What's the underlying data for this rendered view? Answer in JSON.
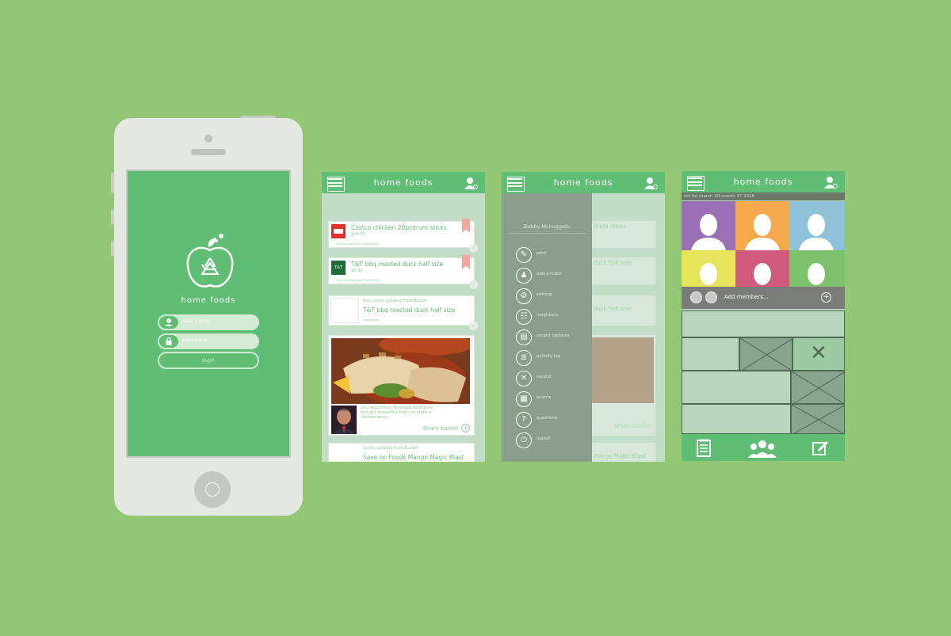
{
  "login": {
    "app_name": "home foods",
    "username_placeholder": "user name",
    "password_placeholder": "password",
    "login_label": "login"
  },
  "header": {
    "title": "home foods"
  },
  "feed": {
    "items": [
      {
        "title": "Costco chicken 20pcdrum sticks",
        "price": "$15.99",
        "address": "7200 Arlington Ave Riverside RI",
        "store_logo": "costco-logo"
      },
      {
        "title": "T&T bbq roasted duck half size",
        "price": "$6.99",
        "address": "7200 Arlington Ave Riverside RI",
        "store_logo": "t-and-t-logo"
      }
    ],
    "update_1": {
      "headline": "Bob Lahey updated Food Basket",
      "title": "T&T bbq roasted duck half size",
      "sub": "view basket"
    },
    "photo_post": {
      "caption": "your neighbour, Guiseppe Rodriguez brought quesadilla that can make a chicken wrap...",
      "share_label": "Share basket"
    },
    "update_2": {
      "headline": "Sasha updated Food Basket",
      "title": "Save on Foods Mango Magic Blast"
    }
  },
  "side_menu": {
    "user_name": "Bobby Mcnuggets",
    "items": [
      {
        "label": "post",
        "icon": "edit-icon",
        "glyph": "✎"
      },
      {
        "label": "add a mate",
        "icon": "person-icon",
        "glyph": "♟"
      },
      {
        "label": "setting",
        "icon": "gear-icon",
        "glyph": "⚙"
      },
      {
        "label": "neighbors",
        "icon": "group-icon",
        "glyph": "☷"
      },
      {
        "label": "recent updates",
        "icon": "document-icon",
        "glyph": "▤"
      },
      {
        "label": "activity log",
        "icon": "list-icon",
        "glyph": "≣"
      },
      {
        "label": "receipt",
        "icon": "close-icon",
        "glyph": "✕"
      },
      {
        "label": "events",
        "icon": "calendar-icon",
        "glyph": "▦"
      },
      {
        "label": "questions",
        "icon": "question-icon",
        "glyph": "?"
      },
      {
        "label": "logout",
        "icon": "power-icon",
        "glyph": "⏻"
      }
    ],
    "bg_labels": {
      "title_1": "drum sticks",
      "title_2": "duck half size",
      "title_3": "duck half size",
      "share": "Share basket",
      "bottom": "Mango Magic Blast"
    }
  },
  "members": {
    "date_range": "list for march 20-march 27 2016",
    "add_members_label": "Add members...",
    "colors": [
      "#9b6fb3",
      "#f5a94a",
      "#8ec2d8",
      "#e6e45a",
      "#cf5a7b",
      "#7cc16b"
    ]
  },
  "colors": {
    "accent": "#5fbd74",
    "background": "#93c774"
  }
}
